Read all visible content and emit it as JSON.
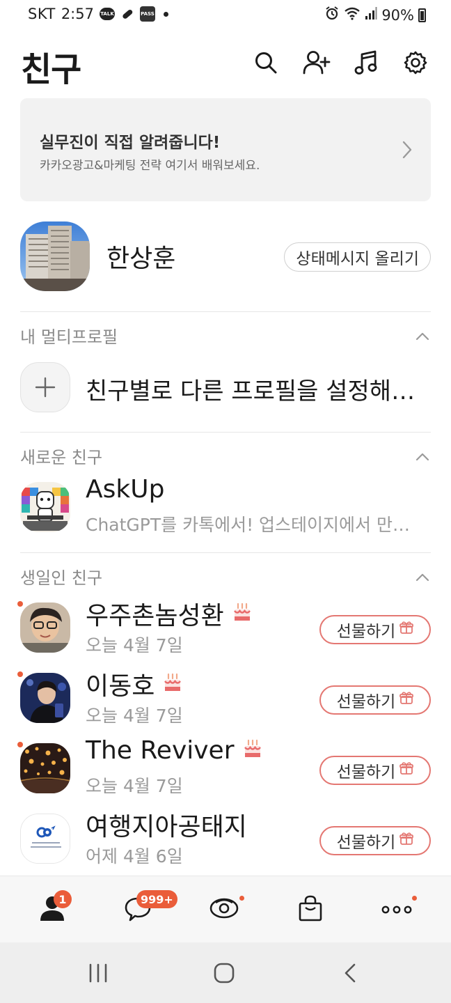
{
  "status_bar": {
    "carrier": "SKT",
    "time": "2:57",
    "talk_icon_text": "TALK",
    "pass_icon_text": "PASS",
    "battery": "90%"
  },
  "header": {
    "title": "친구",
    "icons": [
      "search-icon",
      "add-friend-icon",
      "music-icon",
      "settings-icon"
    ]
  },
  "banner": {
    "title": "실무진이 직접 알려줍니다!",
    "subtitle": "카카오광고&마케팅 전략 여기서 배워보세요."
  },
  "my_profile": {
    "name": "한상훈",
    "status_button": "상태메시지 올리기"
  },
  "multi_profile": {
    "section_title": "내 멀티프로필",
    "prompt": "친구별로 다른 프로필을 설정해보세요"
  },
  "new_friends": {
    "section_title": "새로운 친구",
    "items": [
      {
        "name": "AskUp",
        "subtitle": "ChatGPT를 카톡에서! 업스테이지에서 만든 AI"
      }
    ]
  },
  "birthday": {
    "section_title": "생일인 친구",
    "gift_label": "선물하기",
    "items": [
      {
        "name": "우주촌놈성환",
        "date": "오늘 4월 7일"
      },
      {
        "name": "이동호",
        "date": "오늘 4월 7일"
      },
      {
        "name": "The Reviver",
        "date": "오늘 4월 7일"
      },
      {
        "name": "여행지아공태지",
        "date": "어제 4월 6일"
      }
    ]
  },
  "bottom_nav": {
    "friends_badge": "1",
    "chats_badge": "999+"
  },
  "colors": {
    "accent": "#ea5d3a",
    "gift_border": "#e47772",
    "section_text": "#8a8a8a",
    "banner_bg": "#f2f2f2"
  }
}
